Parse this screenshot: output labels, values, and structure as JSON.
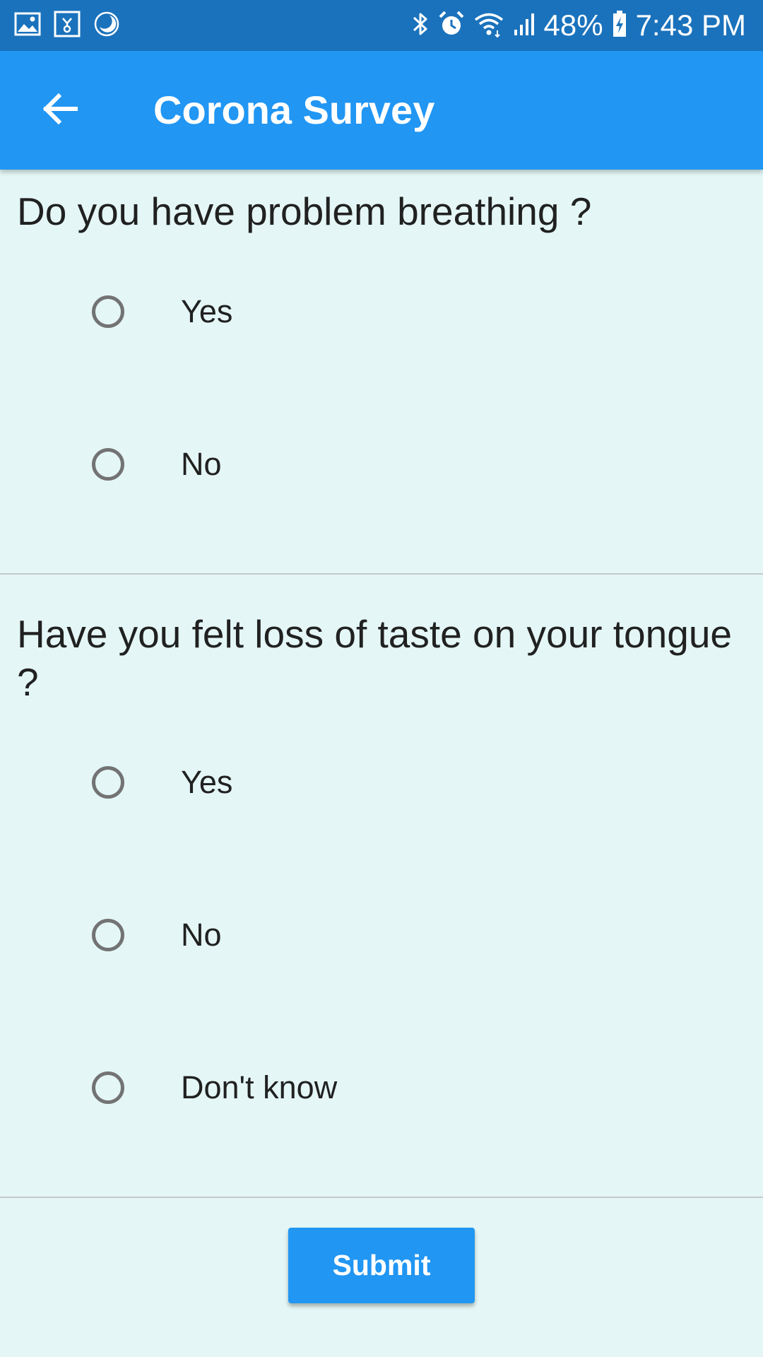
{
  "status_bar": {
    "battery": "48%",
    "time": "7:43 PM",
    "icons": [
      "gallery-icon",
      "notification-icon",
      "moon-icon",
      "bluetooth-icon",
      "alarm-icon",
      "wifi-icon",
      "signal-icon",
      "battery-charging-icon"
    ]
  },
  "app_bar": {
    "title": "Corona Survey",
    "back_icon": "arrow-left-icon"
  },
  "questions": [
    {
      "text": "Do you have problem breathing ?",
      "options": [
        "Yes",
        "No"
      ]
    },
    {
      "text": "Have you felt loss of taste on your tongue ?",
      "options": [
        "Yes",
        "No",
        "Don't know"
      ]
    }
  ],
  "submit_label": "Submit",
  "colors": {
    "status_bar": "#1a72bc",
    "app_bar": "#2196f3",
    "background": "#e4f7f6",
    "radio_border": "#737373",
    "button": "#2196f3"
  }
}
